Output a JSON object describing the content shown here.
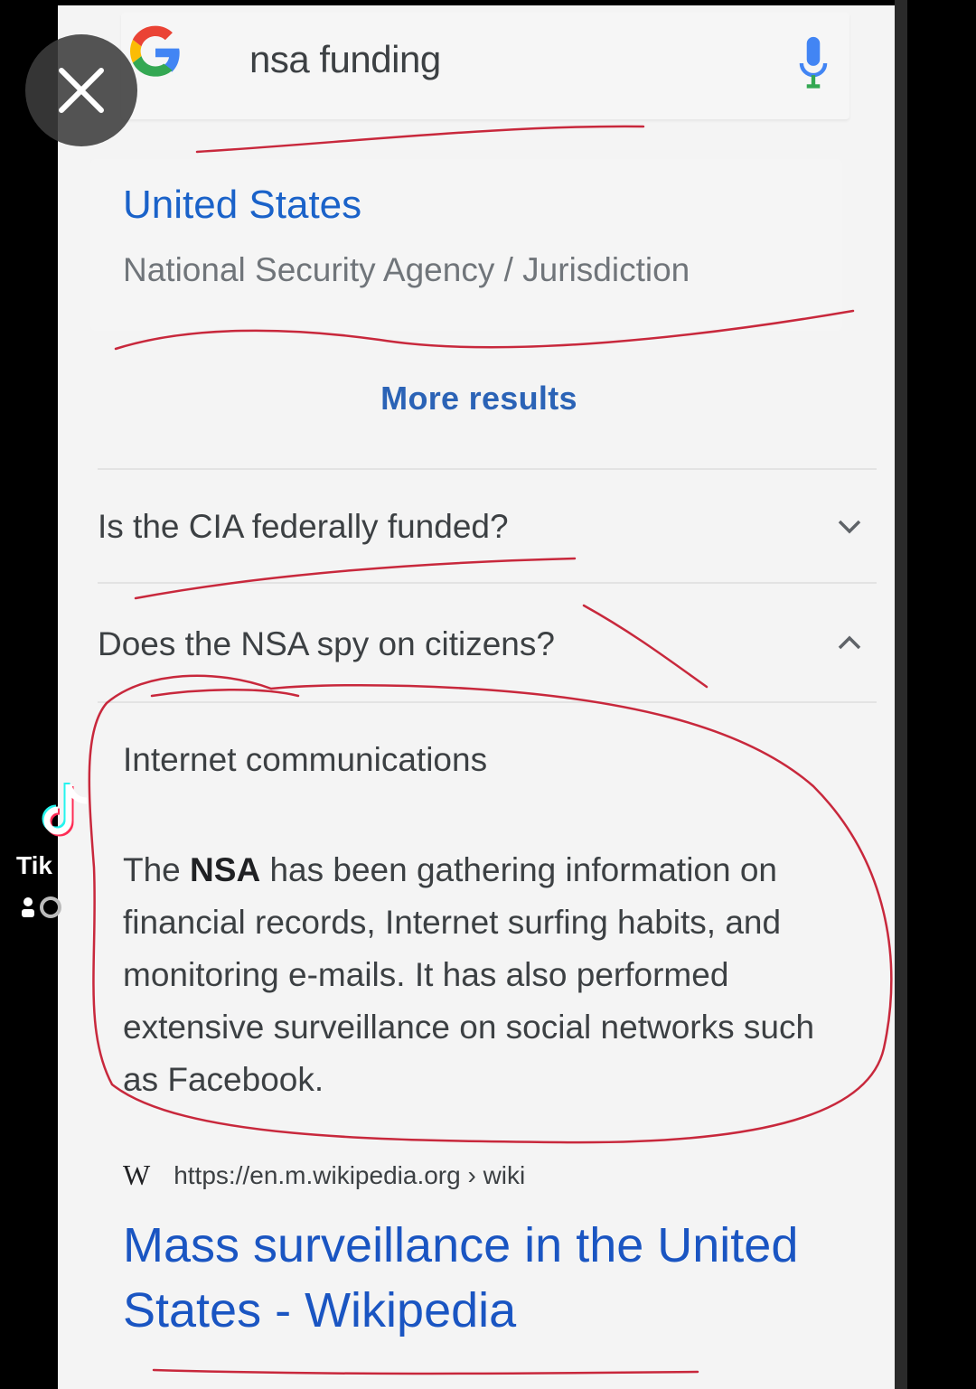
{
  "search": {
    "query": "nsa funding"
  },
  "knowledge_panel": {
    "title": "United States",
    "subtitle": "National Security Agency / Jurisdiction"
  },
  "more_results_label": "More results",
  "faq": [
    {
      "question": "Is the CIA federally funded?",
      "expanded": false
    },
    {
      "question": "Does the NSA spy on citizens?",
      "expanded": true
    }
  ],
  "answer": {
    "heading": "Internet communications",
    "body_before": "The ",
    "body_bold": "NSA",
    "body_after": " has been gathering information on financial records, Internet surfing habits, and monitoring e-mails. It has also performed extensive surveillance on social networks such as Facebook."
  },
  "source": {
    "icon_letter": "W",
    "url": "https://en.m.wikipedia.org › wiki",
    "title": "Mass surveillance in the United States - Wikipedia"
  },
  "overlay": {
    "tiktok_label": "Tik"
  },
  "colors": {
    "link_blue": "#1a62c9",
    "annotation_red": "#c8283c",
    "text_gray": "#3c4043"
  }
}
